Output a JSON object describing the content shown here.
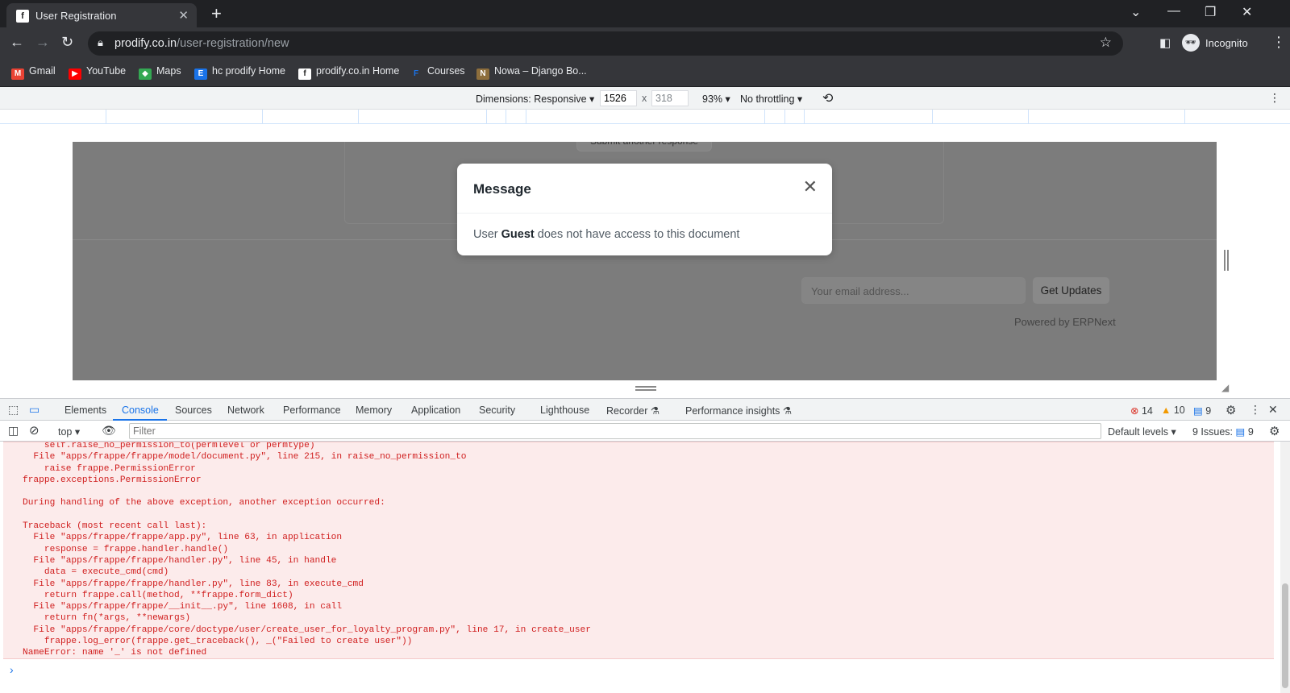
{
  "browser": {
    "tab_title": "User Registration",
    "tab_favicon": "f",
    "url_host": "prodify.co.in",
    "url_path": "/user-registration/new",
    "profile_label": "Incognito",
    "bookmarks": [
      {
        "label": "Gmail",
        "icon": "gmail-icon",
        "color": "#ea4335"
      },
      {
        "label": "YouTube",
        "icon": "youtube-icon",
        "color": "#ff0000"
      },
      {
        "label": "Maps",
        "icon": "maps-icon",
        "color": "#34a853"
      },
      {
        "label": "hc prodify Home",
        "icon": "prodify-icon",
        "color": "#1a73e8"
      },
      {
        "label": "prodify.co.in Home",
        "icon": "prodify-f-icon",
        "color": "#ffffff"
      },
      {
        "label": "Courses",
        "icon": "courses-icon",
        "color": "#1a73e8"
      },
      {
        "label": "Nowa – Django Bo...",
        "icon": "nowa-icon",
        "color": "#8d6e3c"
      }
    ]
  },
  "device_toolbar": {
    "dimensions_label": "Dimensions: Responsive",
    "width": "1526",
    "times": "x",
    "height": "318",
    "zoom": "93%",
    "throttling": "No throttling"
  },
  "page": {
    "submit_another": "Submit another response",
    "email_placeholder": "Your email address...",
    "get_updates": "Get Updates",
    "powered_by": "Powered by ERPNext"
  },
  "modal": {
    "title": "Message",
    "msg_prefix": "User ",
    "msg_user": "Guest",
    "msg_suffix": " does not have access to this document"
  },
  "devtools": {
    "tabs": [
      "Elements",
      "Console",
      "Sources",
      "Network",
      "Performance",
      "Memory",
      "Application",
      "Security",
      "Lighthouse",
      "Recorder",
      "Performance insights"
    ],
    "active_tab": "Console",
    "errors": "14",
    "warnings": "10",
    "messages": "9",
    "context": "top",
    "filter_placeholder": "Filter",
    "levels": "Default levels",
    "issues_label": "9 Issues:",
    "issues_count": "9"
  },
  "console": {
    "log": "    self.raise_no_permission_to(permlevel or permtype)\n  File \"apps/frappe/frappe/model/document.py\", line 215, in raise_no_permission_to\n    raise frappe.PermissionError\nfrappe.exceptions.PermissionError\n\nDuring handling of the above exception, another exception occurred:\n\nTraceback (most recent call last):\n  File \"apps/frappe/frappe/app.py\", line 63, in application\n    response = frappe.handler.handle()\n  File \"apps/frappe/frappe/handler.py\", line 45, in handle\n    data = execute_cmd(cmd)\n  File \"apps/frappe/frappe/handler.py\", line 83, in execute_cmd\n    return frappe.call(method, **frappe.form_dict)\n  File \"apps/frappe/frappe/__init__.py\", line 1608, in call\n    return fn(*args, **newargs)\n  File \"apps/frappe/frappe/core/doctype/user/create_user_for_loyalty_program.py\", line 17, in create_user\n    frappe.log_error(frappe.get_traceback(), _(\"Failed to create user\"))\nNameError: name '_' is not defined"
  }
}
